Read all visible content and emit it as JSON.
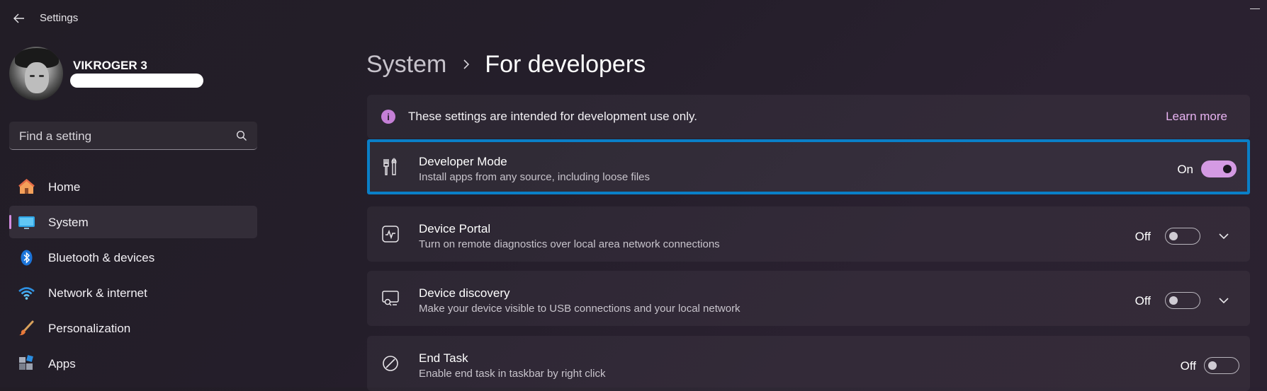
{
  "titlebar": {
    "title": "Settings"
  },
  "user": {
    "name": "VIKROGER 3"
  },
  "search": {
    "placeholder": "Find a setting"
  },
  "nav": {
    "items": [
      {
        "label": "Home",
        "icon": "home-icon",
        "active": false
      },
      {
        "label": "System",
        "icon": "system-icon",
        "active": true
      },
      {
        "label": "Bluetooth & devices",
        "icon": "bluetooth-icon",
        "active": false
      },
      {
        "label": "Network & internet",
        "icon": "wifi-icon",
        "active": false
      },
      {
        "label": "Personalization",
        "icon": "brush-icon",
        "active": false
      },
      {
        "label": "Apps",
        "icon": "apps-icon",
        "active": false
      }
    ]
  },
  "breadcrumb": {
    "parent": "System",
    "current": "For developers"
  },
  "info": {
    "text": "These settings are intended for development use only.",
    "link": "Learn more"
  },
  "settings": [
    {
      "title": "Developer Mode",
      "description": "Install apps from any source, including loose files",
      "state": "On",
      "on": true,
      "expandable": false,
      "icon": "tools-icon"
    },
    {
      "title": "Device Portal",
      "description": "Turn on remote diagnostics over local area network connections",
      "state": "Off",
      "on": false,
      "expandable": true,
      "icon": "pulse-icon"
    },
    {
      "title": "Device discovery",
      "description": "Make your device visible to USB connections and your local network",
      "state": "Off",
      "on": false,
      "expandable": true,
      "icon": "device-discovery-icon"
    },
    {
      "title": "End Task",
      "description": "Enable end task in taskbar by right click",
      "state": "Off",
      "on": false,
      "expandable": false,
      "icon": "block-icon"
    }
  ],
  "colors": {
    "accent": "#d49ae3",
    "focus": "#0a7fc7",
    "link": "#e8b3f2"
  }
}
